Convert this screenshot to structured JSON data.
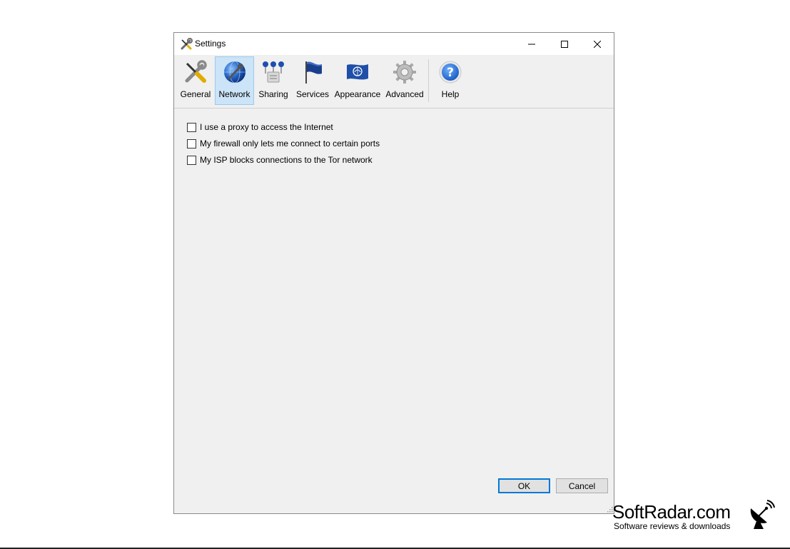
{
  "window": {
    "title": "Settings"
  },
  "toolbar": {
    "items": [
      {
        "label": "General",
        "icon": "wrench-screwdriver-icon"
      },
      {
        "label": "Network",
        "icon": "globe-wrench-icon",
        "selected": true
      },
      {
        "label": "Sharing",
        "icon": "relay-icon"
      },
      {
        "label": "Services",
        "icon": "flag-icon"
      },
      {
        "label": "Appearance",
        "icon": "appearance-flag-icon"
      },
      {
        "label": "Advanced",
        "icon": "gear-icon"
      },
      {
        "label": "Help",
        "icon": "help-icon"
      }
    ]
  },
  "network": {
    "options": [
      {
        "label": "I use a proxy to access the Internet",
        "checked": false
      },
      {
        "label": "My firewall only lets me connect to certain ports",
        "checked": false
      },
      {
        "label": "My ISP blocks connections to the Tor network",
        "checked": false
      }
    ]
  },
  "buttons": {
    "ok": "OK",
    "cancel": "Cancel"
  },
  "watermark": {
    "brand": "SoftRadar.com",
    "tagline": "Software reviews & downloads"
  },
  "colors": {
    "selected_tab_bg": "#cce4f7",
    "selected_tab_border": "#99c9ef",
    "default_button_border": "#0078d7",
    "window_bg": "#f0f0f0"
  }
}
